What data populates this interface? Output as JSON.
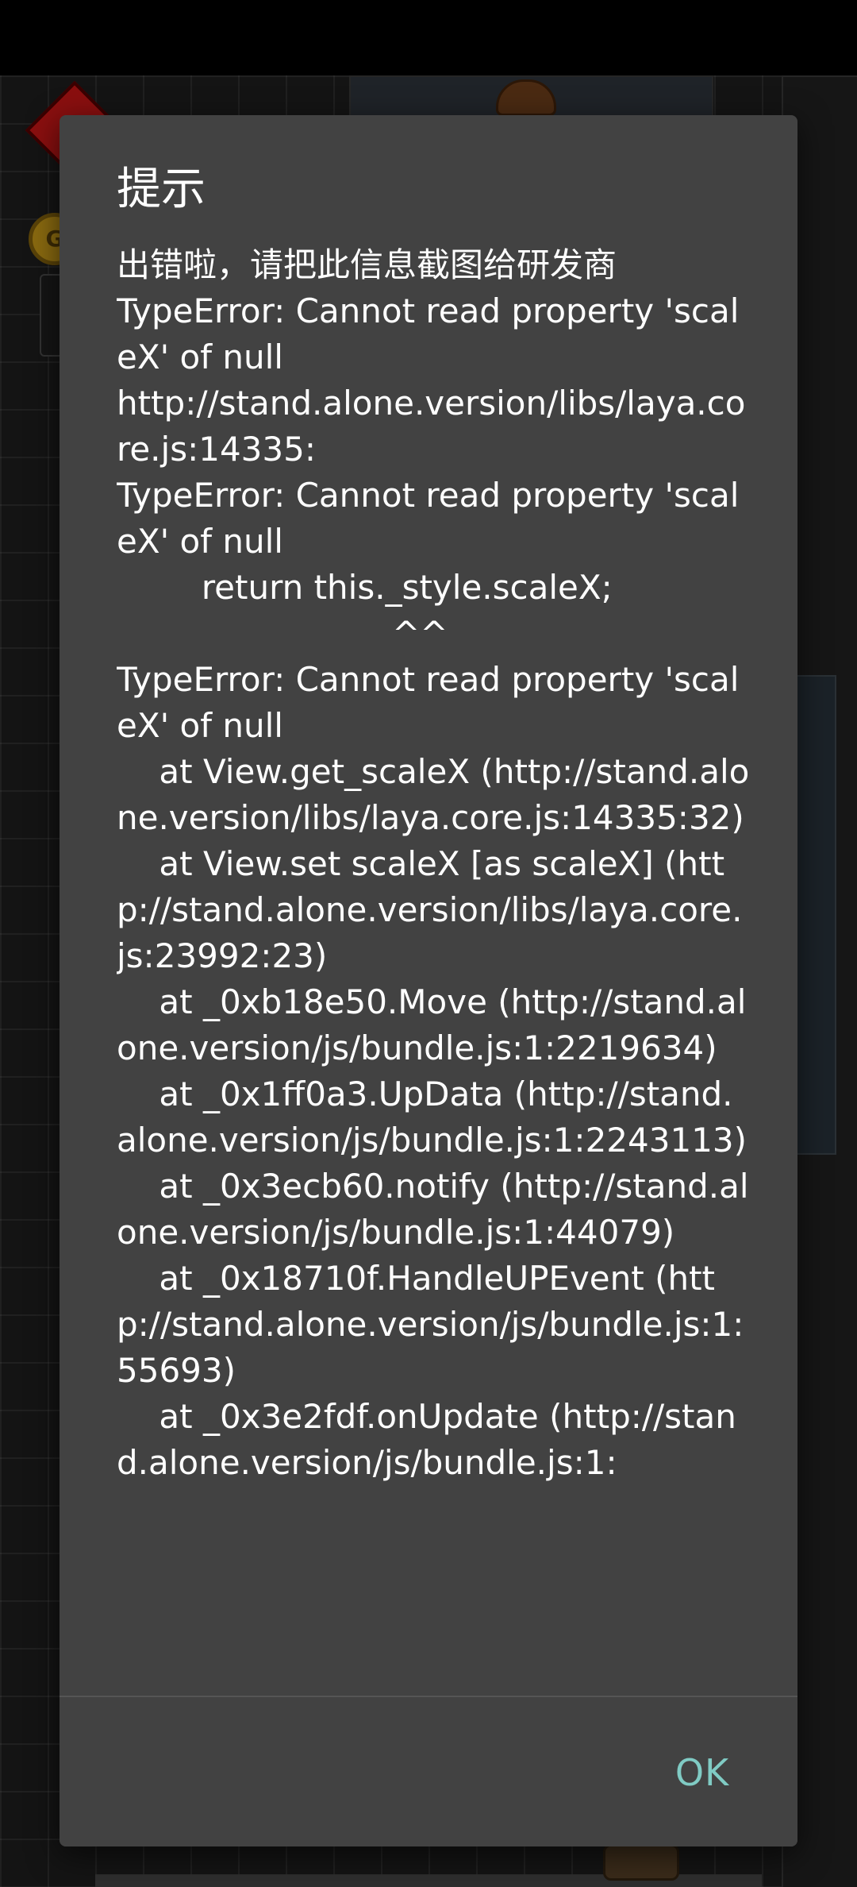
{
  "dialog": {
    "title": "提示",
    "message": "出错啦，请把此信息截图给研发商\nTypeError: Cannot read property 'scaleX' of null\nhttp://stand.alone.version/libs/laya.core.js:14335:\nTypeError: Cannot read property 'scaleX' of null\n        return this._style.scaleX;\n                          ^^\nTypeError: Cannot read property 'scaleX' of null\n    at View.get_scaleX (http://stand.alone.version/libs/laya.core.js:14335:32)\n    at View.set scaleX [as scaleX] (http://stand.alone.version/libs/laya.core.js:23992:23)\n    at _0xb18e50.Move (http://stand.alone.version/js/bundle.js:1:2219634)\n    at _0x1ff0a3.UpData (http://stand.alone.version/js/bundle.js:1:2243113)\n    at _0x3ecb60.notify (http://stand.alone.version/js/bundle.js:1:44079)\n    at _0x18710f.HandleUPEvent (http://stand.alone.version/js/bundle.js:1:55693)\n    at _0x3e2fdf.onUpdate (http://stand.alone.version/js/bundle.js:1:",
    "ok_label": "OK",
    "ok_color": "#80cbc4",
    "background_color": "#424242"
  },
  "background": {
    "coin_icon_letter": "G"
  }
}
